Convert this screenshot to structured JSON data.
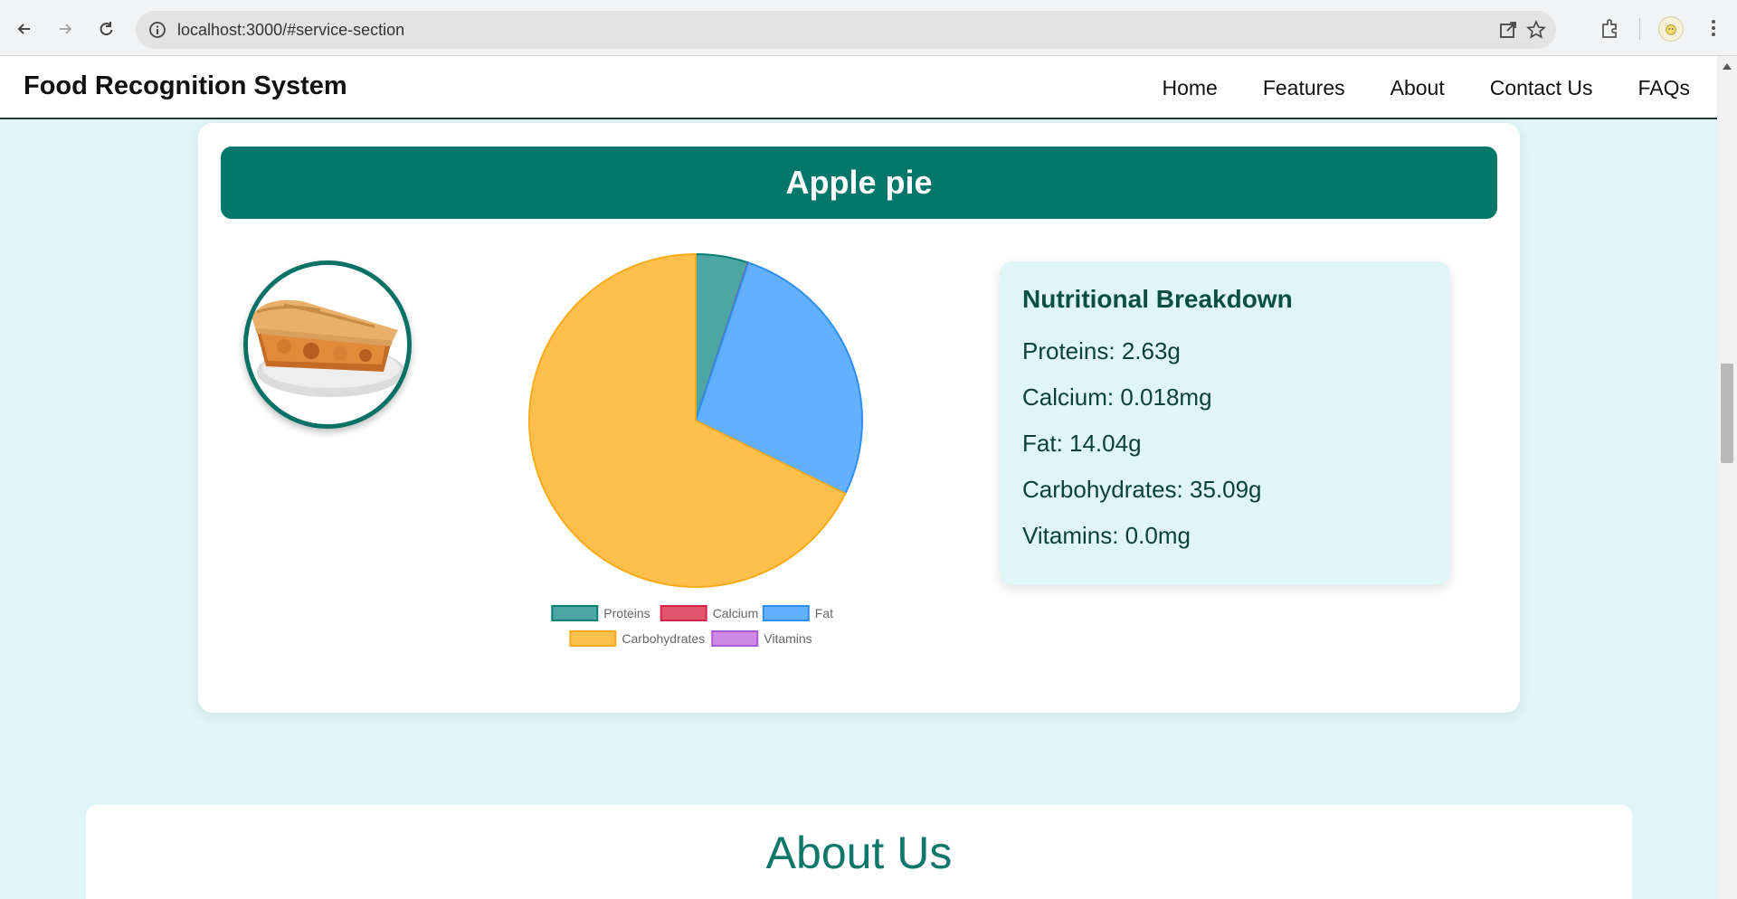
{
  "browser": {
    "url": "localhost:3000/#service-section"
  },
  "header": {
    "brand": "Food Recognition System",
    "nav": [
      "Home",
      "Features",
      "About",
      "Contact Us",
      "FAQs"
    ]
  },
  "result": {
    "food_name": "Apple pie",
    "breakdown_title": "Nutritional Breakdown",
    "items": [
      "Proteins: 2.63g",
      "Calcium: 0.018mg",
      "Fat: 14.04g",
      "Carbohydrates: 35.09g",
      "Vitamins: 0.0mg"
    ]
  },
  "chart_data": {
    "type": "pie",
    "categories": [
      "Proteins",
      "Calcium",
      "Fat",
      "Carbohydrates",
      "Vitamins"
    ],
    "values": [
      2.63,
      0.018,
      14.04,
      35.09,
      0.0
    ],
    "colors": [
      "#4ba6a4",
      "#e2556f",
      "#62b0ff",
      "#ffbf4d",
      "#cf8ae8"
    ],
    "borders": [
      "#087c76",
      "#d92349",
      "#2f8ff0",
      "#f7ab18",
      "#ae57d6"
    ],
    "legend": "bottom"
  },
  "about": {
    "title": "About Us"
  }
}
